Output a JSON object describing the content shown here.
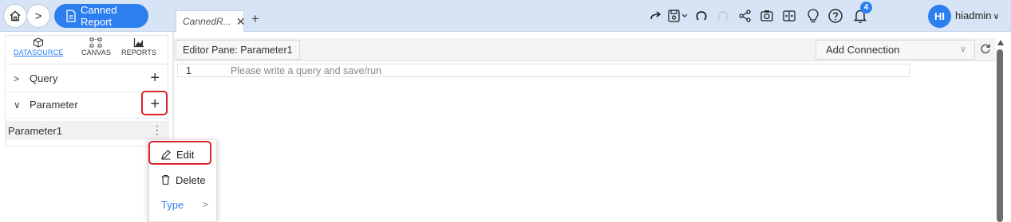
{
  "header": {
    "breadcrumb_arrow": ">",
    "report_label": "Canned Report",
    "tab_label": "CannedR...",
    "tab_close": "✕",
    "tab_add": "+",
    "notification_count": "4",
    "avatar_initials": "HI",
    "username": "hiadmin"
  },
  "datasource_tabs": [
    {
      "label": "DATASOURCE",
      "icon": "cube-icon",
      "active": true
    },
    {
      "label": "CANVAS",
      "icon": "canvas-icon",
      "active": false
    },
    {
      "label": "REPORTS",
      "icon": "chart-icon",
      "active": false
    }
  ],
  "tree": {
    "query_label": "Query",
    "parameter_label": "Parameter",
    "expand_glyph": ">",
    "collapse_glyph": "∨",
    "add_glyph": "+",
    "param_item": "Parameter1",
    "kebab": "⋮"
  },
  "editor": {
    "title": "Editor Pane: Parameter1",
    "connection_placeholder": "Add Connection",
    "connection_dropdown": "∨",
    "line_number": "1",
    "line_placeholder": "Please write a query and save/run"
  },
  "context_menu": {
    "edit": "Edit",
    "delete": "Delete",
    "type": "Type",
    "type_arrow": ">"
  },
  "colors": {
    "accent": "#2d7ff0",
    "highlight": "#d9262c",
    "topbar": "#d6e4f5"
  }
}
